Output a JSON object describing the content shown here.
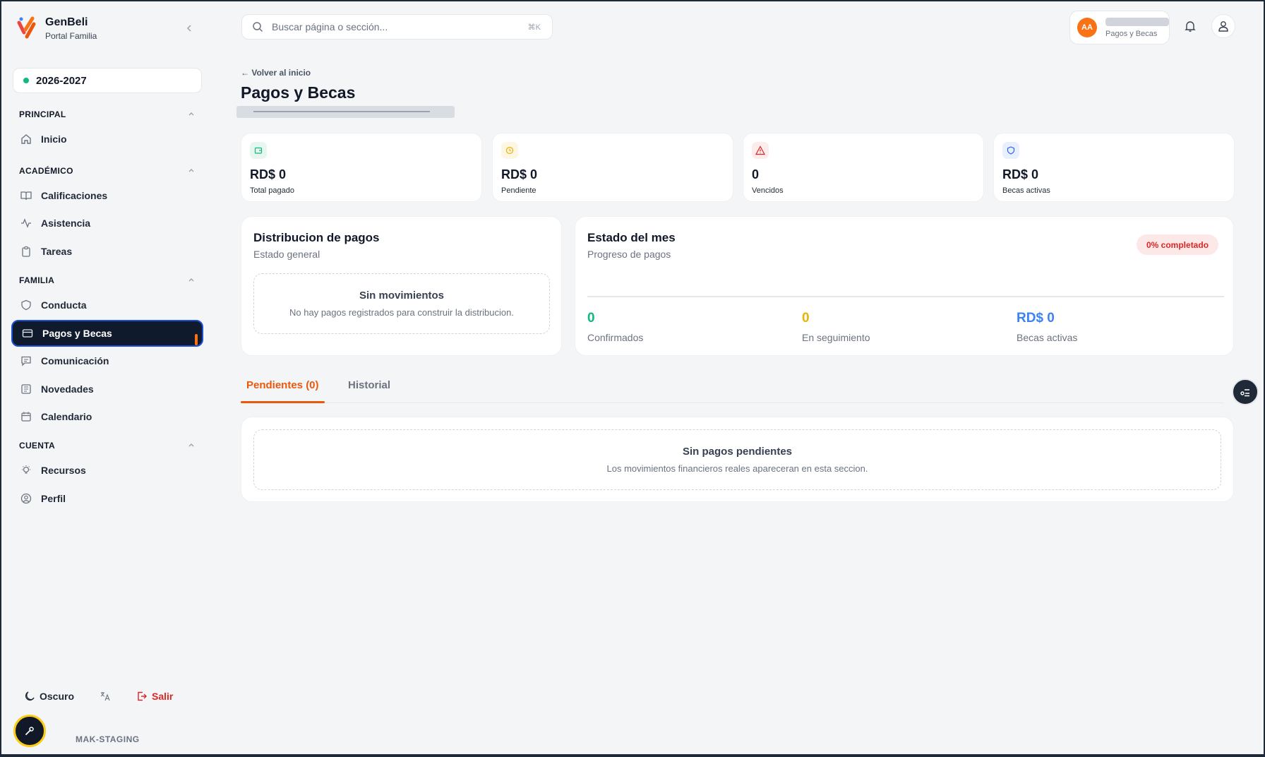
{
  "app": {
    "name": "GenBeli",
    "subtitle": "Portal Familia"
  },
  "school_year": "2026-2027",
  "sidebar": {
    "sections": [
      {
        "title": "PRINCIPAL",
        "items": [
          {
            "label": "Inicio",
            "icon": "home-icon"
          }
        ]
      },
      {
        "title": "ACADÉMICO",
        "items": [
          {
            "label": "Calificaciones",
            "icon": "book-icon"
          },
          {
            "label": "Asistencia",
            "icon": "activity-icon"
          },
          {
            "label": "Tareas",
            "icon": "clipboard-icon"
          }
        ]
      },
      {
        "title": "FAMILIA",
        "items": [
          {
            "label": "Conducta",
            "icon": "shield-icon"
          },
          {
            "label": "Pagos y Becas",
            "icon": "credit-card-icon",
            "active": true
          },
          {
            "label": "Comunicación",
            "icon": "message-icon"
          },
          {
            "label": "Novedades",
            "icon": "news-icon"
          },
          {
            "label": "Calendario",
            "icon": "calendar-icon"
          }
        ]
      },
      {
        "title": "CUENTA",
        "items": [
          {
            "label": "Recursos",
            "icon": "lightbulb-icon"
          },
          {
            "label": "Perfil",
            "icon": "user-circle-icon"
          }
        ]
      }
    ],
    "bottom": {
      "theme_label": "Oscuro",
      "logout_label": "Salir",
      "env_label": "MAK-STAGING"
    }
  },
  "topbar": {
    "search_placeholder": "Buscar página o sección...",
    "search_shortcut": "⌘K",
    "user_initials": "AA",
    "user_page": "Pagos y Becas"
  },
  "header": {
    "back_label": "← Volver al inicio",
    "title": "Pagos y Becas"
  },
  "stats": [
    {
      "value": "RD$ 0",
      "label": "Total pagado",
      "icon": "wallet-icon",
      "color": "#10b981",
      "bg": "#e7f7ef"
    },
    {
      "value": "RD$ 0",
      "label": "Pendiente",
      "icon": "clock-icon",
      "color": "#eab308",
      "bg": "#fdf6e3"
    },
    {
      "value": "0",
      "label": "Vencidos",
      "icon": "alert-triangle-icon",
      "color": "#dc2626",
      "bg": "#fdecec"
    },
    {
      "value": "RD$ 0",
      "label": "Becas activas",
      "icon": "shield-icon",
      "color": "#2563eb",
      "bg": "#e8f0fd"
    }
  ],
  "distribution": {
    "title": "Distribucion de pagos",
    "subtitle": "Estado general",
    "empty_title": "Sin movimientos",
    "empty_desc": "No hay pagos registrados para construir la distribucion."
  },
  "month": {
    "title": "Estado del mes",
    "subtitle": "Progreso de pagos",
    "badge": "0% completado",
    "progress": 0,
    "stats": [
      {
        "value": "0",
        "label": "Confirmados",
        "color": "#10b981"
      },
      {
        "value": "0",
        "label": "En seguimiento",
        "color": "#eab308"
      },
      {
        "value": "RD$ 0",
        "label": "Becas activas",
        "color": "#3b82f6"
      }
    ]
  },
  "tabs": [
    {
      "label": "Pendientes (0)",
      "active": true
    },
    {
      "label": "Historial",
      "active": false
    }
  ],
  "pending": {
    "empty_title": "Sin pagos pendientes",
    "empty_desc": "Los movimientos financieros reales apareceran en esta seccion."
  },
  "colors": {
    "accent": "#ea580c",
    "active_nav_bg": "#0f1b2d"
  }
}
